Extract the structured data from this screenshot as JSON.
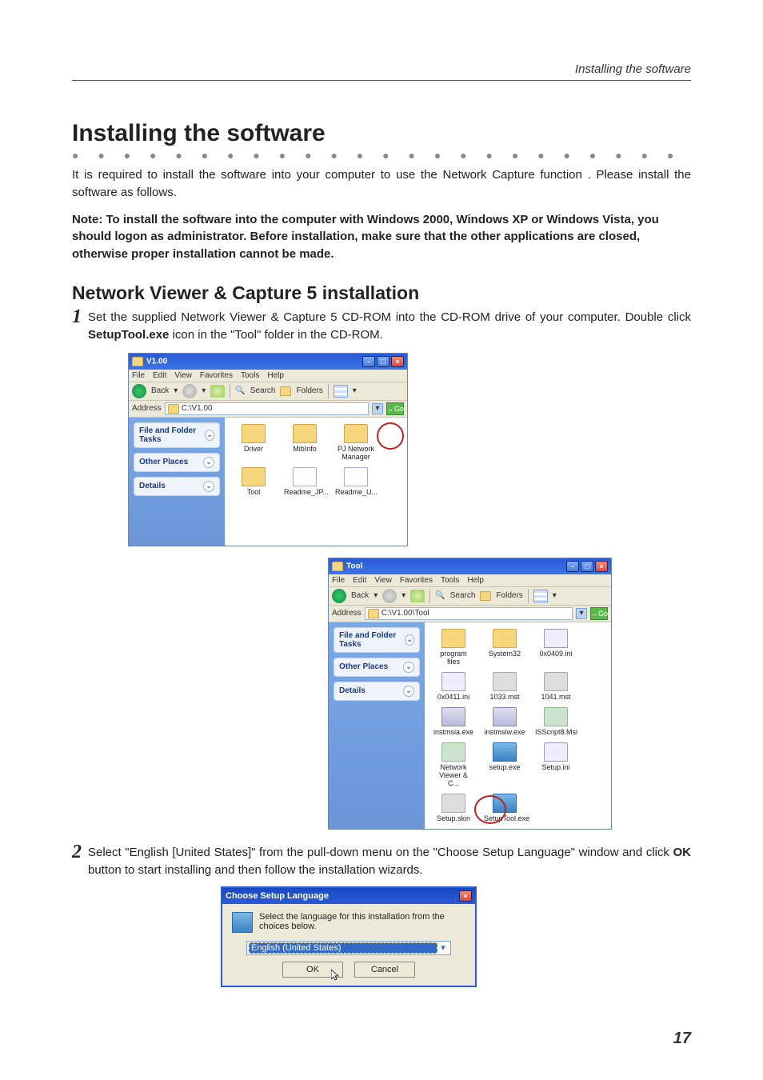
{
  "running_head": "Installing the software",
  "h1": "Installing the software",
  "intro": "It is required to install the software into your computer to use the Network Capture function . Please install the software as follows.",
  "note_label": "Note:",
  "note_body": "To install the software into the computer with Windows 2000, Windows XP or Windows Vista, you should logon as administrator. Before installation, make sure that the other applications are closed, otherwise proper installation cannot be made.",
  "h2": "Network Viewer & Capture 5 installation",
  "step1": {
    "num": "1",
    "pre": "Set the supplied Network Viewer & Capture 5 CD-ROM into the CD-ROM drive of your computer. Double click ",
    "bold": "SetupTool.exe",
    "post": " icon in the \"Tool\" folder in the CD-ROM."
  },
  "step2": {
    "num": "2",
    "pre": "Select \"English [United States]\" from the pull-down menu on the \"Choose Setup Language\" window and click ",
    "bold": "OK",
    "post": " button to start installing and then follow the installation wizards."
  },
  "explorer_common": {
    "menu": [
      "File",
      "Edit",
      "View",
      "Favorites",
      "Tools",
      "Help"
    ],
    "back": "Back",
    "search": "Search",
    "folders": "Folders",
    "address": "Address",
    "go": "Go",
    "side": {
      "tasks": "File and Folder Tasks",
      "other": "Other Places",
      "details": "Details"
    }
  },
  "win1": {
    "title": "V1.00",
    "path": "C:\\V1.00",
    "files": [
      {
        "name": "Driver",
        "t": "folder"
      },
      {
        "name": "MibInfo",
        "t": "folder"
      },
      {
        "name": "PJ Network Manager",
        "t": "folder"
      },
      {
        "name": "Tool",
        "t": "folder"
      },
      {
        "name": "Readme_JP...",
        "t": "txt"
      },
      {
        "name": "Readme_U...",
        "t": "txt"
      }
    ]
  },
  "win2": {
    "title": "Tool",
    "path": "C:\\V1.00\\Tool",
    "files": [
      {
        "name": "program files",
        "t": "folder"
      },
      {
        "name": "System32",
        "t": "folder"
      },
      {
        "name": "0x0409.ini",
        "t": "ini"
      },
      {
        "name": "0x0411.ini",
        "t": "ini"
      },
      {
        "name": "1033.mst",
        "t": "grey"
      },
      {
        "name": "1041.mst",
        "t": "grey"
      },
      {
        "name": "instmsia.exe",
        "t": "exe"
      },
      {
        "name": "instmsiw.exe",
        "t": "exe"
      },
      {
        "name": "ISScript8.Msi",
        "t": "msi"
      },
      {
        "name": "Network Viewer & C...",
        "t": "msi"
      },
      {
        "name": "setup.exe",
        "t": "blue"
      },
      {
        "name": "Setup.ini",
        "t": "ini"
      },
      {
        "name": "Setup.skin",
        "t": "grey"
      },
      {
        "name": "SetupTool.exe",
        "t": "blue"
      }
    ]
  },
  "lang": {
    "title": "Choose Setup Language",
    "msg": "Select the language for this installation from the choices below.",
    "value": "English (United States)",
    "ok": "OK",
    "cancel": "Cancel"
  },
  "page_num": "17"
}
